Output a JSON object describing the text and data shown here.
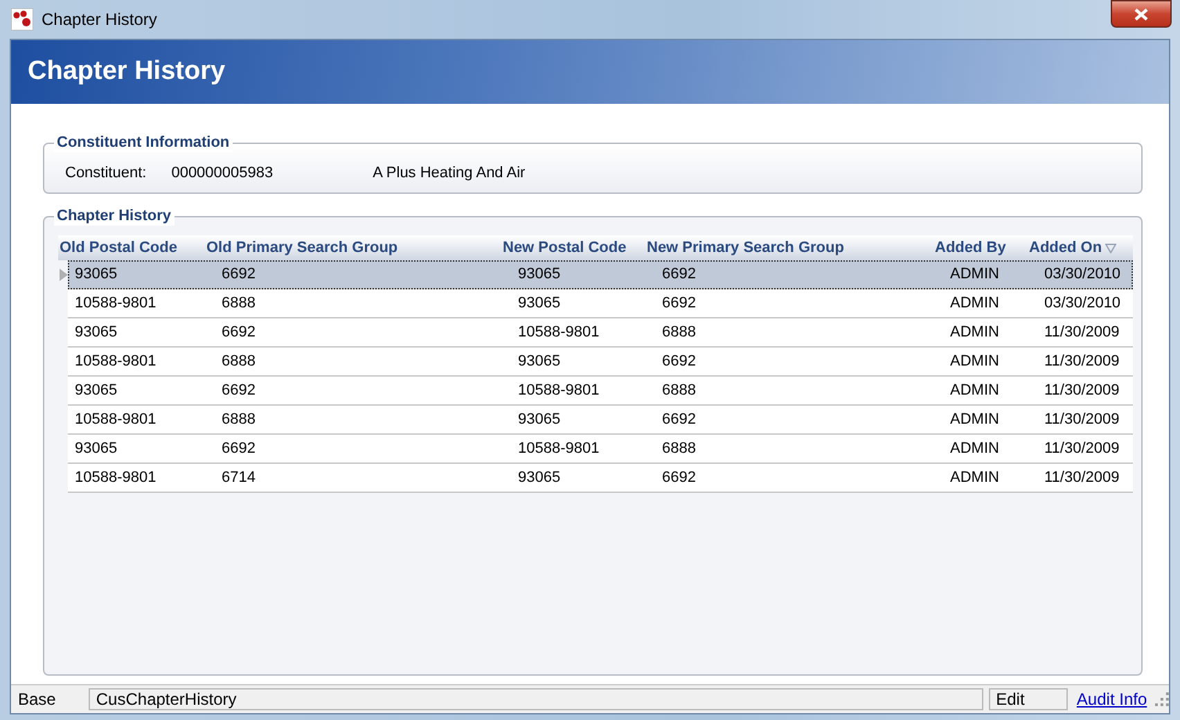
{
  "window": {
    "title": "Chapter History"
  },
  "header": {
    "title": "Chapter History"
  },
  "constituent_info": {
    "legend": "Constituent Information",
    "label": "Constituent:",
    "number": "000000005983",
    "name": "A Plus Heating And Air"
  },
  "chapter_history": {
    "legend": "Chapter History",
    "columns": [
      {
        "label": "Old Postal Code",
        "sorted": false
      },
      {
        "label": "Old Primary Search Group",
        "sorted": false
      },
      {
        "label": "New Postal Code",
        "sorted": false
      },
      {
        "label": "New Primary Search Group",
        "sorted": false
      },
      {
        "label": "Added By",
        "sorted": false
      },
      {
        "label": "Added On",
        "sorted": true
      }
    ],
    "rows": [
      {
        "selected": true,
        "cells": [
          "93065",
          "6692",
          "93065",
          "6692",
          "ADMIN",
          "03/30/2010"
        ]
      },
      {
        "selected": false,
        "cells": [
          "10588-9801",
          "6888",
          "93065",
          "6692",
          "ADMIN",
          "03/30/2010"
        ]
      },
      {
        "selected": false,
        "cells": [
          "93065",
          "6692",
          "10588-9801",
          "6888",
          "ADMIN",
          "11/30/2009"
        ]
      },
      {
        "selected": false,
        "cells": [
          "10588-9801",
          "6888",
          "93065",
          "6692",
          "ADMIN",
          "11/30/2009"
        ]
      },
      {
        "selected": false,
        "cells": [
          "93065",
          "6692",
          "10588-9801",
          "6888",
          "ADMIN",
          "11/30/2009"
        ]
      },
      {
        "selected": false,
        "cells": [
          "10588-9801",
          "6888",
          "93065",
          "6692",
          "ADMIN",
          "11/30/2009"
        ]
      },
      {
        "selected": false,
        "cells": [
          "93065",
          "6692",
          "10588-9801",
          "6888",
          "ADMIN",
          "11/30/2009"
        ]
      },
      {
        "selected": false,
        "cells": [
          "10588-9801",
          "6714",
          "93065",
          "6692",
          "ADMIN",
          "11/30/2009"
        ]
      }
    ]
  },
  "status_bar": {
    "base": "Base",
    "form": "CusChapterHistory",
    "mode": "Edit",
    "link": "Audit Info"
  }
}
